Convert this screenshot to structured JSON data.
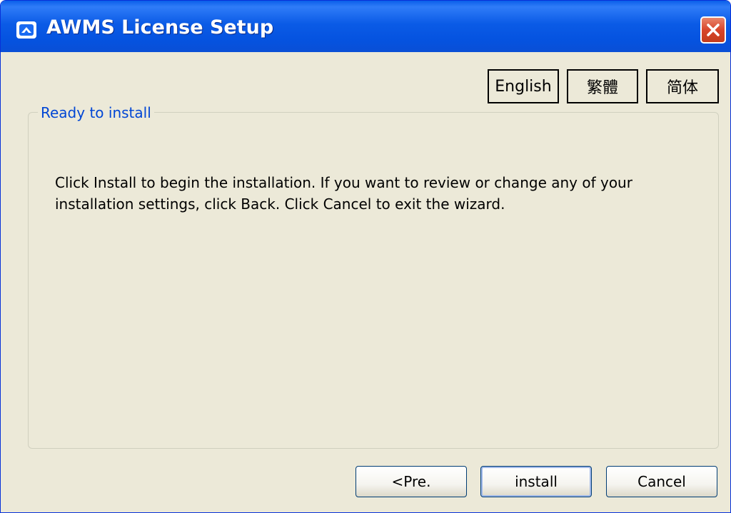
{
  "window": {
    "title": "AWMS License Setup",
    "title_bar_color": "#0a5fe9",
    "close_button_color": "#d8452a"
  },
  "language_buttons": [
    {
      "label": "English"
    },
    {
      "label": "繁體"
    },
    {
      "label": "简体"
    }
  ],
  "group": {
    "label": "Ready to install",
    "message": "Click Install to begin the installation.  If you want to review or change any of your\ninstallation settings, click Back.  Click Cancel to exit the wizard."
  },
  "buttons": {
    "previous": "<Pre.",
    "install": "install",
    "cancel": "Cancel"
  },
  "icons": {
    "app": "app-logo-icon",
    "close": "close-icon"
  }
}
